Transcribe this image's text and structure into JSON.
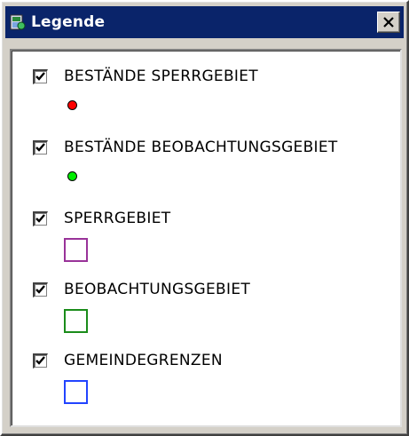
{
  "window": {
    "title": "Legende",
    "close_label": "✕",
    "colors": {
      "titlebar": "#0a246a",
      "face": "#d4d0c8"
    }
  },
  "legend": {
    "items": [
      {
        "label": "BESTÄNDE SPERRGEBIET",
        "checked": true,
        "symbol": "point",
        "color": "#ff0000"
      },
      {
        "label": "BESTÄNDE BEOBACHTUNGSGEBIET",
        "checked": true,
        "symbol": "point",
        "color": "#00ee00"
      },
      {
        "label": "SPERRGEBIET",
        "checked": true,
        "symbol": "polygon",
        "color": "#993399"
      },
      {
        "label": "BEOBACHTUNGSGEBIET",
        "checked": true,
        "symbol": "polygon",
        "color": "#1a8c1a"
      },
      {
        "label": "GEMEINDEGRENZEN",
        "checked": true,
        "symbol": "polygon",
        "color": "#2244ff"
      }
    ]
  }
}
